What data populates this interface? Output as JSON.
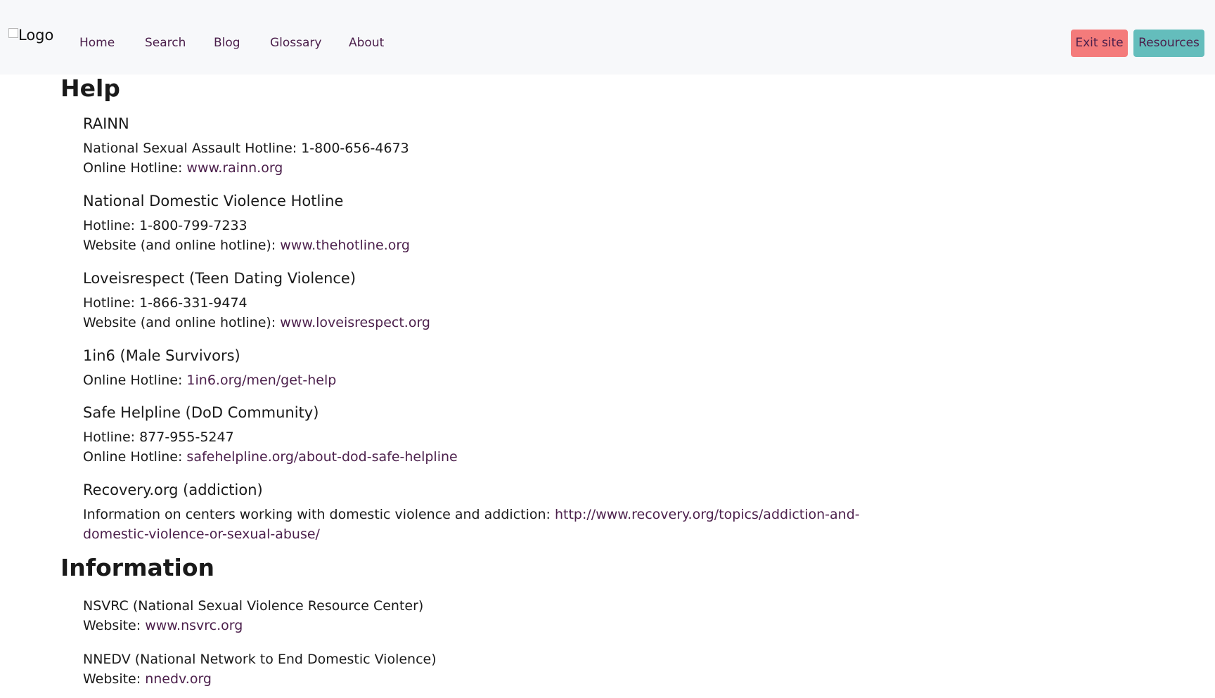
{
  "nav": {
    "logo_alt": "Logo",
    "items": [
      {
        "label": "Home"
      },
      {
        "label": "Search"
      },
      {
        "label": "Blog"
      },
      {
        "label": "Glossary"
      },
      {
        "label": "About"
      }
    ],
    "exit_label": "Exit site",
    "resources_label": "Resources"
  },
  "colors": {
    "exit_button": "#f47b7b",
    "resources_button": "#64bdbc",
    "link": "#4b1f4b",
    "header_bg": "#f7f8fa"
  },
  "help": {
    "heading": "Help",
    "orgs": [
      {
        "name": "RAINN",
        "lines": [
          {
            "label": "National Sexual Assault Hotline: 1-800-656-4673",
            "link": ""
          },
          {
            "label": "Online Hotline: ",
            "link": "www.rainn.org"
          }
        ]
      },
      {
        "name": "National Domestic Violence Hotline",
        "lines": [
          {
            "label": "Hotline: 1-800-799-7233",
            "link": ""
          },
          {
            "label": "Website (and online hotline): ",
            "link": "www.thehotline.org"
          }
        ]
      },
      {
        "name": "Loveisrespect (Teen Dating Violence)",
        "lines": [
          {
            "label": "Hotline: 1-866-331-9474",
            "link": ""
          },
          {
            "label": "Website (and online hotline): ",
            "link": "www.loveisrespect.org"
          }
        ]
      },
      {
        "name": "1in6 (Male Survivors)",
        "lines": [
          {
            "label": "Online Hotline: ",
            "link": "1in6.org/men/get-help"
          }
        ]
      },
      {
        "name": "Safe Helpline (DoD Community)",
        "lines": [
          {
            "label": "Hotline: 877-955-5247",
            "link": ""
          },
          {
            "label": "Online Hotline: ",
            "link": "safehelpline.org/about-dod-safe-helpline"
          }
        ]
      },
      {
        "name": "Recovery.org (addiction)",
        "lines": [
          {
            "label": "Information on centers working with domestic violence and addiction: ",
            "link": "http://www.recovery.org/topics/addiction-and-"
          },
          {
            "label": "",
            "link": "domestic-violence-or-sexual-abuse/"
          }
        ]
      }
    ]
  },
  "information": {
    "heading": "Information",
    "orgs": [
      {
        "name": "NSVRC (National Sexual Violence Resource Center)",
        "lines": [
          {
            "label": "Website: ",
            "link": "www.nsvrc.org"
          }
        ]
      },
      {
        "name": "NNEDV (National Network to End Domestic Violence)",
        "lines": [
          {
            "label": "Website: ",
            "link": "nnedv.org"
          }
        ]
      }
    ]
  }
}
